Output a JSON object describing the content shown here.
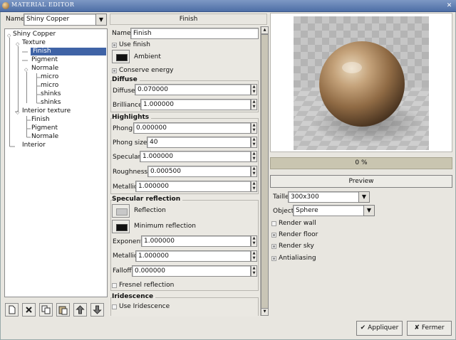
{
  "window": {
    "title": "MATERIAL EDITOR",
    "close_glyph": "✕"
  },
  "left": {
    "name_label": "Name",
    "name_value": "Shiny Copper",
    "tree": {
      "root": "Shiny Copper",
      "texture": "Texture",
      "finish": "Finish",
      "pigment": "Pigment",
      "normale": "Normale",
      "micro1": "micro",
      "micro2": "micro",
      "shinks1": "shinks",
      "shinks2": "shinks",
      "interior_texture": "Interior texture",
      "it_finish": "Finish",
      "it_pigment": "Pigment",
      "it_normale": "Normale",
      "interior": "Interior"
    }
  },
  "finish": {
    "header": "Finish",
    "name_label": "Name",
    "name_value": "Finish",
    "use_finish": "Use finish",
    "ambient": "Ambient",
    "conserve_energy": "Conserve energy",
    "diffuse_group": "Diffuse",
    "diffuse_label": "Diffuse",
    "diffuse_value": "0.070000",
    "brilliance_label": "Brilliance",
    "brilliance_value": "1.000000",
    "highlights_group": "Highlights",
    "phong_label": "Phong",
    "phong_value": "0.000000",
    "phong_size_label": "Phong size",
    "phong_size_value": "40",
    "specular_label": "Specular",
    "specular_value": "1.000000",
    "roughness_label": "Roughness",
    "roughness_value": "0.000500",
    "metallic_label": "Metallic",
    "metallic_value": "1.000000",
    "specular_reflection_group": "Specular reflection",
    "reflection": "Reflection",
    "minimum_reflection": "Minimum reflection",
    "exponent_label": "Exponent",
    "exponent_value": "1.000000",
    "sr_metallic_label": "Metallic",
    "sr_metallic_value": "1.000000",
    "falloff_label": "Falloff",
    "falloff_value": "0.000000",
    "fresnel_reflection": "Fresnel reflection",
    "iridescence_group": "Iridescence",
    "use_iridescence": "Use Iridescence"
  },
  "preview": {
    "progress": 0,
    "progress_text": "0 %",
    "preview_button": "Preview",
    "taille_label": "Taille",
    "taille_value": "300x300",
    "object_label": "Object",
    "object_value": "Sphere",
    "render_wall": "Render wall",
    "render_floor": "Render floor",
    "render_sky": "Render sky",
    "antialiasing": "Antialiasing"
  },
  "footer": {
    "apply": "Appliquer",
    "close": "Fermer"
  },
  "colors": {
    "selection": "#3f63a6",
    "title_bar": "#5b79ae",
    "progress": "#c9c5b0"
  }
}
